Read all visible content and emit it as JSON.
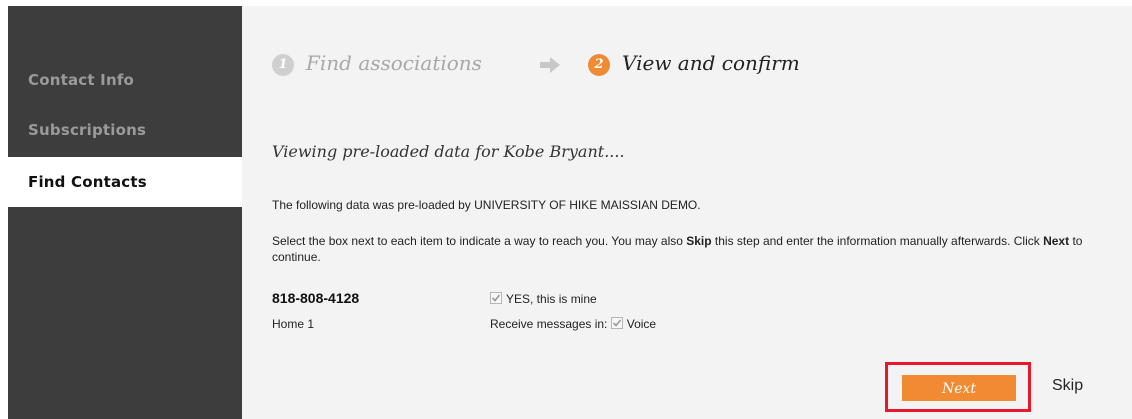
{
  "sidebar": {
    "items": [
      {
        "label": "Contact Info",
        "active": false
      },
      {
        "label": "Subscriptions",
        "active": false
      },
      {
        "label": "Find Contacts",
        "active": true
      }
    ]
  },
  "steps": [
    {
      "number": "1",
      "label": "Find associations",
      "state": "inactive"
    },
    {
      "number": "2",
      "label": "View and confirm",
      "state": "active"
    }
  ],
  "colors": {
    "accent": "#f08a33",
    "step_inactive": "#cfcfcf",
    "highlight_box": "#e8182c"
  },
  "content": {
    "heading": "Viewing pre-loaded data for Kobe Bryant....",
    "preloaded_text": "The following data was pre-loaded by UNIVERSITY OF HIKE MAISSIAN DEMO.",
    "instr_part1": "Select the box next to each item to indicate a way to reach you. You may also ",
    "instr_skip": "Skip",
    "instr_part2": " this step and enter the information manually afterwards. Click ",
    "instr_next": "Next",
    "instr_part3": " to continue."
  },
  "contact": {
    "phone": "818-808-4128",
    "type": "Home 1",
    "confirm_label": "YES, this is mine",
    "confirm_checked": true,
    "receive_label": "Receive messages in:",
    "voice_label": "Voice",
    "voice_checked": true
  },
  "actions": {
    "next_label": "Next",
    "skip_label": "Skip"
  }
}
